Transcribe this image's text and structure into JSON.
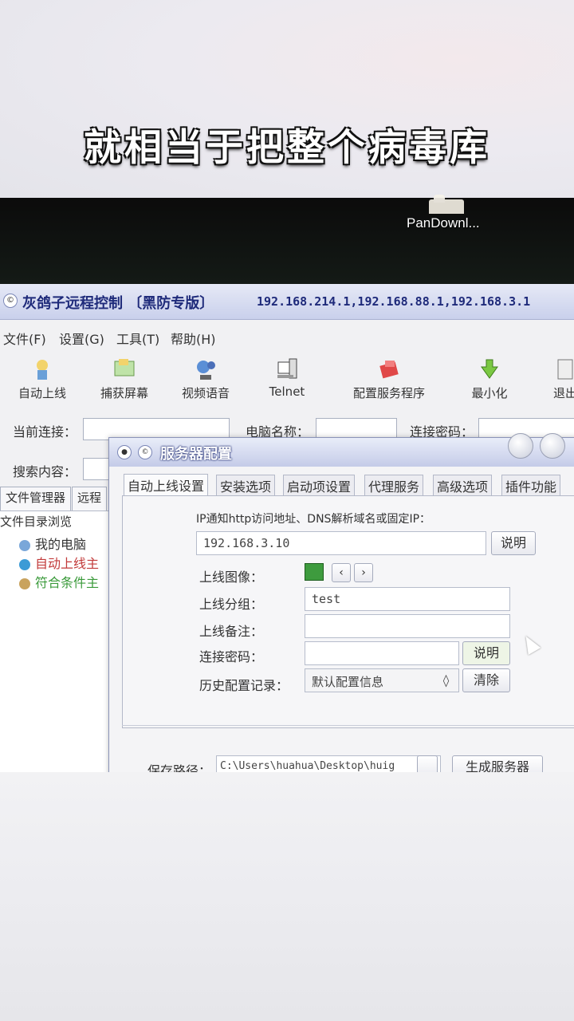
{
  "caption": "就相当于把整个病毒库",
  "desktop": {
    "icon_label": "PanDownl..."
  },
  "app": {
    "title": "灰鸽子远程控制 〔黑防专版〕",
    "ip_list": "192.168.214.1,192.168.88.1,192.168.3.1",
    "menu": [
      "文件(F)",
      "设置(G)",
      "工具(T)",
      "帮助(H)"
    ],
    "toolbar": [
      "自动上线",
      "捕获屏幕",
      "视频语音",
      "Telnet",
      "配置服务程序",
      "最小化",
      "退出"
    ],
    "fields": {
      "current_conn": "当前连接：",
      "computer_name": "电脑名称：",
      "conn_password": "连接密码：",
      "search": "搜索内容："
    },
    "left_tabs": [
      "文件管理器",
      "远程"
    ],
    "tree_header": "文件目录浏览",
    "tree": [
      "我的电脑",
      "自动上线主",
      "符合条件主"
    ]
  },
  "dialog": {
    "title": "服务器配置",
    "tabs": [
      "自动上线设置",
      "安装选项",
      "启动项设置",
      "代理服务",
      "高级选项",
      "插件功能"
    ],
    "ip_label": "IP通知http访问地址、DNS解析域名或固定IP：",
    "ip_value": "192.168.3.10",
    "explain": "说明",
    "icon_label": "上线图像：",
    "group_label": "上线分组：",
    "group_value": "test",
    "note_label": "上线备注：",
    "pwd_label": "连接密码：",
    "history_label": "历史配置记录：",
    "history_value": "默认配置信息",
    "clear": "清除",
    "save_label": "保存路径：",
    "save_path": "C:\\Users\\huahua\\Desktop\\huig",
    "generate": "生成服务器"
  }
}
